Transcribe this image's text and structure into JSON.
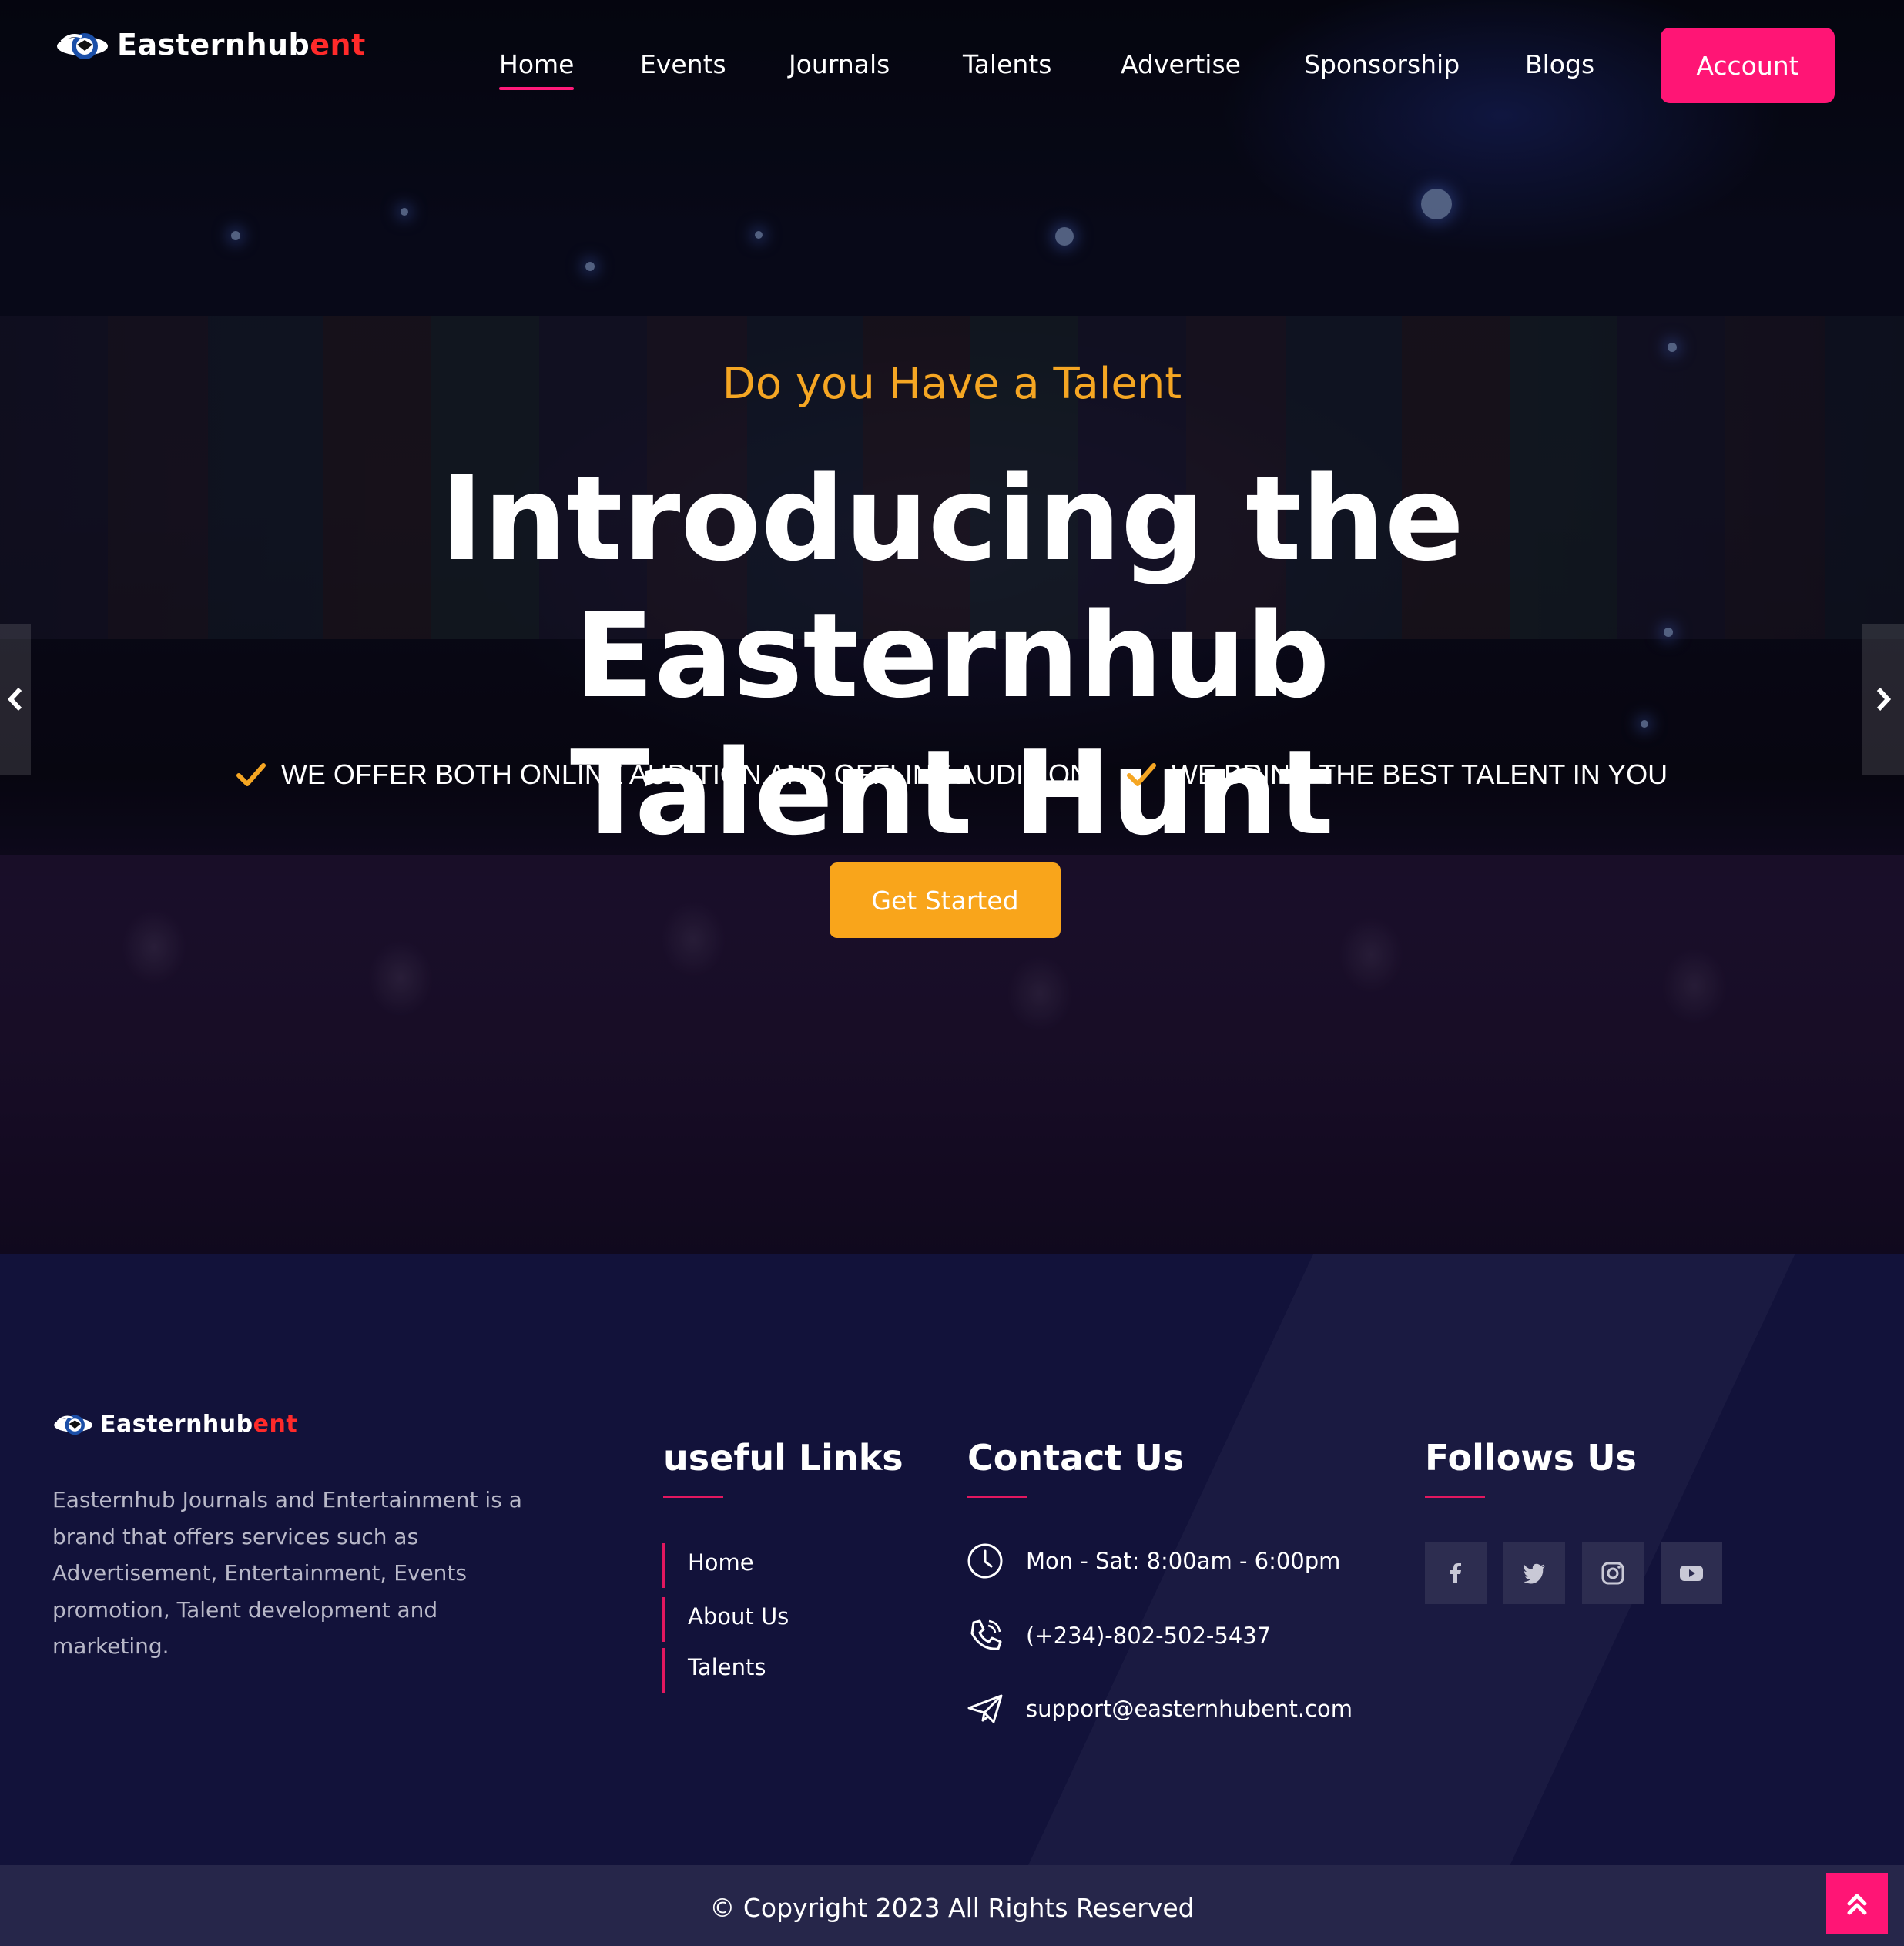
{
  "brand": {
    "name_main": "Easternhub",
    "name_accent": "ent"
  },
  "nav": {
    "items": [
      {
        "label": "Home",
        "active": true
      },
      {
        "label": "Events"
      },
      {
        "label": "Journals"
      },
      {
        "label": "Talents"
      },
      {
        "label": "Advertise"
      },
      {
        "label": "Sponsorship"
      },
      {
        "label": "Blogs"
      }
    ],
    "account_label": "Account"
  },
  "hero": {
    "kicker": "Do you Have a Talent",
    "headline_line1": "Introducing the Easternhub",
    "headline_line2": "Talent Hunt",
    "features": [
      "WE OFFER BOTH ONLINE AUDITION AND OFFLINE AUDITION",
      "WE BRING THE BEST TALENT IN YOU"
    ],
    "cta_label": "Get Started"
  },
  "footer": {
    "about": "Easternhub Journals and Entertainment is a brand that offers services such as Advertisement, Entertainment, Events promotion, Talent development and marketing.",
    "useful_links": {
      "heading": "useful Links",
      "items": [
        "Home",
        "About Us",
        "Talents"
      ]
    },
    "contact": {
      "heading": "Contact Us",
      "hours": "Mon - Sat: 8:00am - 6:00pm",
      "phone": "(+234)-802-502-5437",
      "email": "support@easternhubent.com"
    },
    "follow": {
      "heading": "Follows Us",
      "icons": [
        "facebook-icon",
        "twitter-icon",
        "instagram-icon",
        "youtube-icon"
      ]
    },
    "copyright": "© Copyright 2023 All Rights Reserved"
  },
  "colors": {
    "accent_pink": "#ff1575",
    "accent_orange": "#f9a51b",
    "footer_bg": "#12123a"
  }
}
